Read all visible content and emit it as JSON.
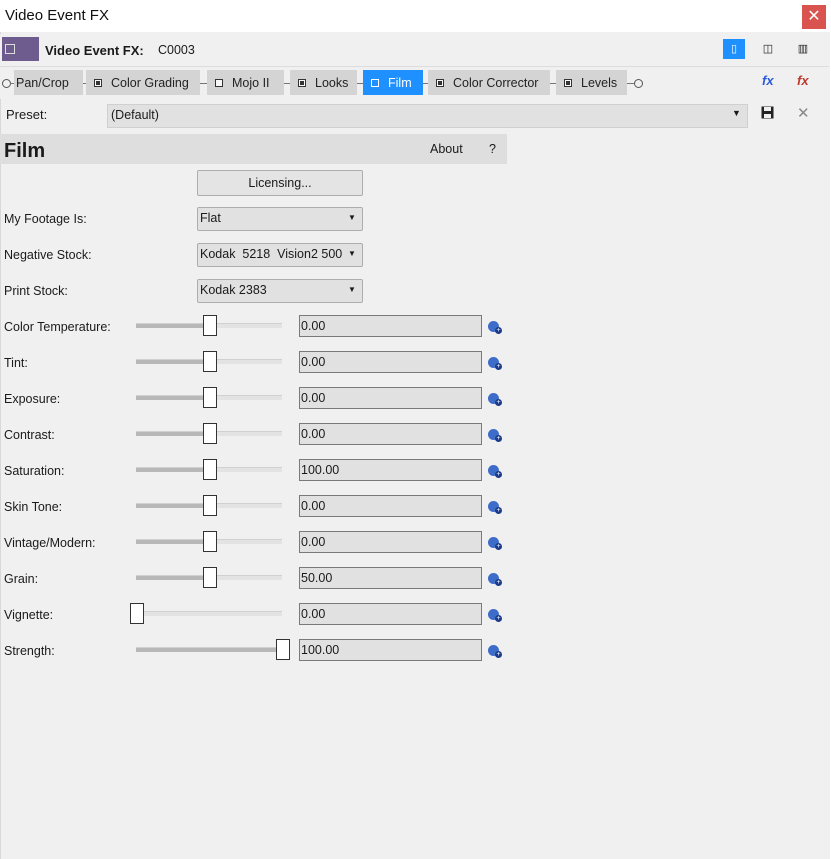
{
  "window": {
    "title": "Video Event FX",
    "close_glyph": "✕"
  },
  "header": {
    "label": "Video Event FX:",
    "value": "C0003"
  },
  "chain": {
    "tabs": [
      {
        "label": "Pan/Crop",
        "checkbox": false,
        "active": false
      },
      {
        "label": "Color Grading",
        "checkbox": true,
        "active": false
      },
      {
        "label": "Mojo II",
        "checkbox": false,
        "active": false
      },
      {
        "label": "Looks",
        "checkbox": true,
        "active": false
      },
      {
        "label": "Film",
        "checkbox": false,
        "active": true
      },
      {
        "label": "Color Corrector",
        "checkbox": true,
        "active": false
      },
      {
        "label": "Levels",
        "checkbox": true,
        "active": false
      }
    ],
    "fx_add_glyph": "fx",
    "fx_remove_glyph": "fx"
  },
  "preset": {
    "label": "Preset:",
    "value": "(Default)"
  },
  "panel": {
    "title": "Film",
    "about": "About",
    "help": "?"
  },
  "licensing_label": "Licensing...",
  "combos": {
    "footage": {
      "label": "My Footage Is:",
      "value": "Flat"
    },
    "negative": {
      "label": "Negative Stock:",
      "value": "Kodak  5218  Vision2 500"
    },
    "print": {
      "label": "Print Stock:",
      "value": "Kodak 2383"
    }
  },
  "params": {
    "color_temperature": {
      "label": "Color Temperature:",
      "value": "0.00",
      "level": 0.5
    },
    "tint": {
      "label": "Tint:",
      "value": "0.00",
      "level": 0.5
    },
    "exposure": {
      "label": "Exposure:",
      "value": "0.00",
      "level": 0.5
    },
    "contrast": {
      "label": "Contrast:",
      "value": "0.00",
      "level": 0.5
    },
    "saturation": {
      "label": "Saturation:",
      "value": "100.00",
      "level": 0.5
    },
    "skin_tone": {
      "label": "Skin Tone:",
      "value": "0.00",
      "level": 0.5
    },
    "vintage_modern": {
      "label": "Vintage/Modern:",
      "value": "0.00",
      "level": 0.5
    },
    "grain": {
      "label": "Grain:",
      "value": "50.00",
      "level": 0.5
    },
    "vignette": {
      "label": "Vignette:",
      "value": "0.00",
      "level": 0.0
    },
    "strength": {
      "label": "Strength:",
      "value": "100.00",
      "level": 1.0
    }
  },
  "colors": {
    "accent": "#1e90ff",
    "close": "#d9534f",
    "keyframe": "#3d6cc9"
  }
}
